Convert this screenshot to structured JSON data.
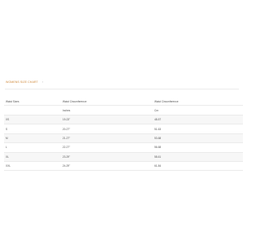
{
  "section": {
    "title": "WOMENS SIZE CHART",
    "toggle_icon": "chevron-icon"
  },
  "table": {
    "headers": [
      "Waist Sizes",
      "Waist Circumference",
      "Waist Circumference"
    ],
    "units": [
      "",
      "Inches",
      "Cm"
    ],
    "rows": [
      [
        "XS",
        "19-23\"",
        "48-57"
      ],
      [
        "S",
        "20-27\"",
        "51-63"
      ],
      [
        "M",
        "21-27\"",
        "53-68"
      ],
      [
        "L",
        "22-27\"",
        "56-68"
      ],
      [
        "XL",
        "23-29\"",
        "58-61"
      ],
      [
        "XXL",
        "24-29\"",
        "61-84"
      ]
    ]
  }
}
